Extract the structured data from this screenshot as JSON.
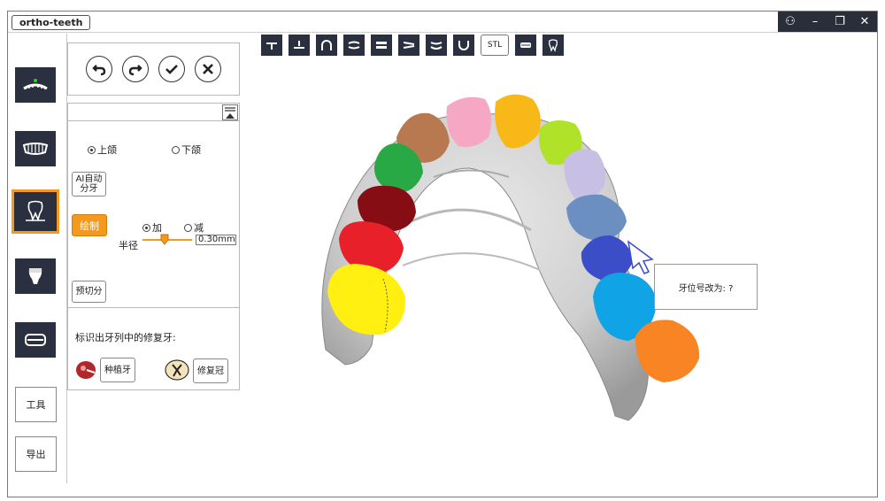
{
  "app": {
    "title": "ortho-teeth"
  },
  "window_controls": [
    {
      "name": "user-icon",
      "glyph": "⚇"
    },
    {
      "name": "minimize-icon",
      "glyph": "–"
    },
    {
      "name": "restore-icon",
      "glyph": "❐"
    },
    {
      "name": "close-icon",
      "glyph": "✕"
    }
  ],
  "toolbar": {
    "stl_label": "STL"
  },
  "sidebar": {
    "tools_label": "工具",
    "export_label": "导出"
  },
  "jaw": {
    "upper_label": "上颌",
    "lower_label": "下颌",
    "upper_selected": true
  },
  "ai_button": {
    "line1": "AI自动",
    "line2": "分牙"
  },
  "draw_button": "绘制",
  "mode": {
    "add_label": "加",
    "subtract_label": "减",
    "add_selected": true
  },
  "radius": {
    "label": "半径",
    "value": "0.30mm",
    "fraction": 0.45
  },
  "precut_button": "预切分",
  "restoration": {
    "heading": "标识出牙列中的修复牙:",
    "implant_label": "种植牙",
    "crown_label": "修复冠"
  },
  "tooltip": {
    "text": "牙位号改为: ?"
  },
  "colors": {
    "accent": "#f39a1e",
    "dark": "#2b3040"
  }
}
